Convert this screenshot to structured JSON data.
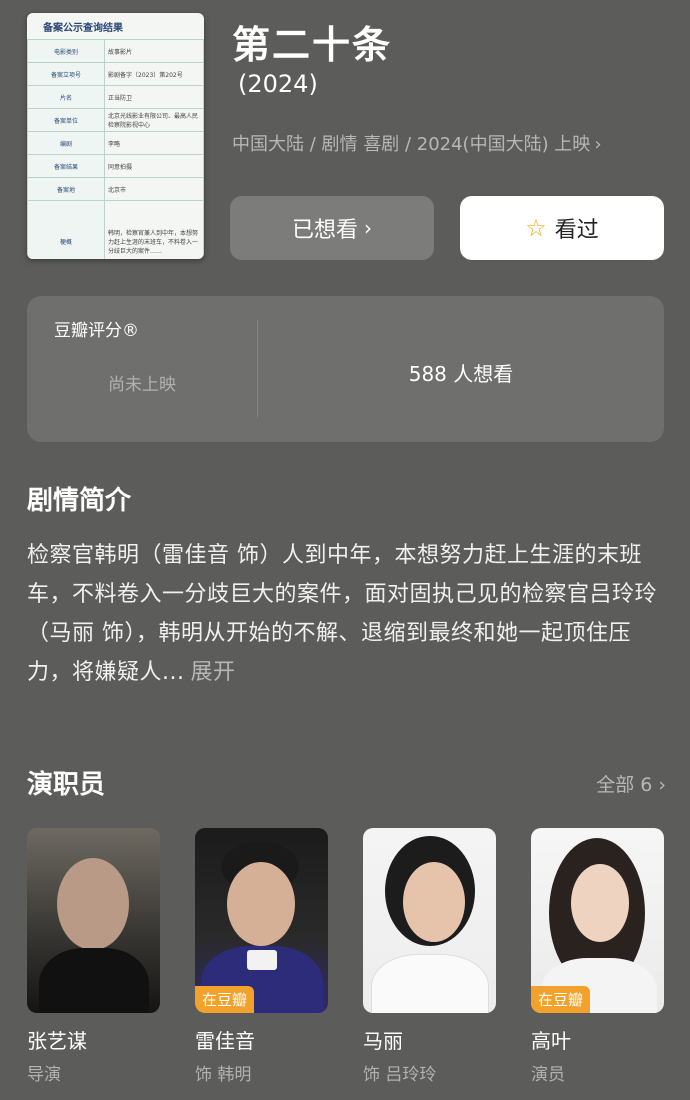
{
  "movie": {
    "title": "第二十条",
    "year": "(2024)",
    "meta": "中国大陆 / 剧情 喜剧 / 2024(中国大陆) 上映"
  },
  "poster": {
    "heading": "备案公示查询结果",
    "rows": [
      {
        "k": "电影类别",
        "v": "故事影片"
      },
      {
        "k": "备案立项号",
        "v": "影剧备字〔2023〕第202号"
      },
      {
        "k": "片名",
        "v": "正当防卫"
      },
      {
        "k": "备案单位",
        "v": "北京光线影业有限公司、最高人民检察院影视中心"
      },
      {
        "k": "编剧",
        "v": "李略"
      },
      {
        "k": "备案结果",
        "v": "同意拍摄"
      },
      {
        "k": "备案地",
        "v": "北京市"
      },
      {
        "k": "梗概",
        "v": "韩明，检察官兼人到中年，本想努力赶上生涯的末班车，不料卷入一分歧巨大的案件……"
      }
    ]
  },
  "actions": {
    "wanted_label": "已想看",
    "seen_label": "看过"
  },
  "rating": {
    "title": "豆瓣评分®",
    "status": "尚未上映",
    "wish_count": "588 人想看"
  },
  "plot": {
    "section_title": "剧情简介",
    "text": "检察官韩明（雷佳音 饰）人到中年，本想努力赶上生涯的末班车，不料卷入一分歧巨大的案件，面对固执己见的检察官吕玲玲（马丽 饰），韩明从开始的不解、退缩到最终和她一起顶住压力，将嫌疑人...",
    "expand_label": "展开"
  },
  "cast": {
    "section_title": "演职员",
    "all_label": "全部 6",
    "members": [
      {
        "name": "张艺谋",
        "role": "导演",
        "badge": ""
      },
      {
        "name": "雷佳音",
        "role": "饰 韩明",
        "badge": "在豆瓣"
      },
      {
        "name": "马丽",
        "role": "饰 吕玲玲",
        "badge": ""
      },
      {
        "name": "高叶",
        "role": "演员",
        "badge": "在豆瓣"
      }
    ]
  },
  "colors": {
    "background": "#5c5c5a",
    "badge": "#f3a12b",
    "star": "#f3a91b"
  }
}
